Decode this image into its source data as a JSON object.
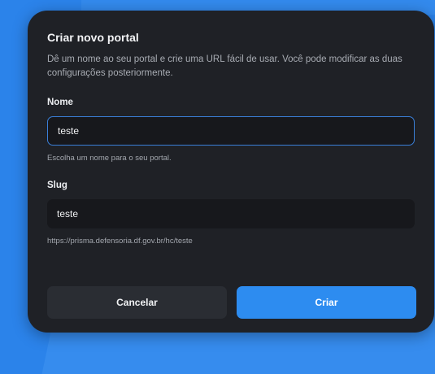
{
  "colors": {
    "background": "#2b83ea",
    "modal": "#1f2126",
    "input": "#17181c",
    "focus_border": "#3a7fd8",
    "primary": "#2d8cf0",
    "secondary": "#2a2d33"
  },
  "modal": {
    "title": "Criar novo portal",
    "description": "Dê um nome ao seu portal e crie uma URL fácil de usar. Você pode modificar as duas configurações posteriormente.",
    "name_field": {
      "label": "Nome",
      "value": "teste",
      "hint": "Escolha um nome para o seu portal."
    },
    "slug_field": {
      "label": "Slug",
      "value": "teste",
      "hint": "https://prisma.defensoria.df.gov.br/hc/teste"
    },
    "actions": {
      "cancel_label": "Cancelar",
      "submit_label": "Criar"
    }
  }
}
